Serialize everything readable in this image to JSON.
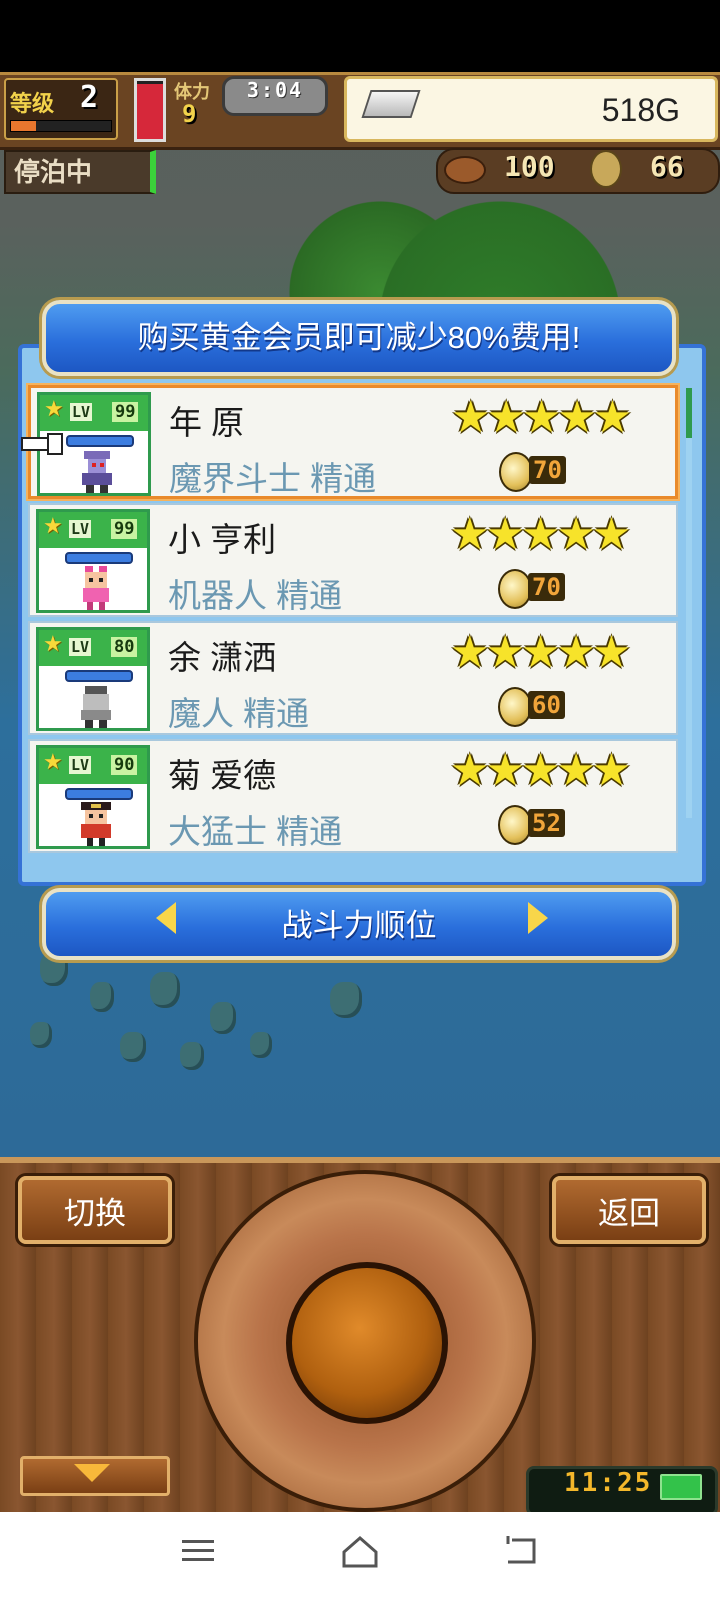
{
  "hud": {
    "level_label": "等级",
    "level_value": "2",
    "level_progress": 0.25,
    "hp_progress": 0.95,
    "stamina_label": "体力",
    "stamina_value": "9",
    "time": "3:04",
    "gold": "518G",
    "dock_status": "停泊中",
    "food": "100",
    "medals": "66"
  },
  "banner": {
    "text": "购买黄金会员即可减少80%费用!"
  },
  "candidates": [
    {
      "name": "年 原",
      "job": "魔界斗士 精通",
      "level": "99",
      "stars": 5,
      "cost": "70",
      "selected": true
    },
    {
      "name": "小 亨利",
      "job": "机器人 精通",
      "level": "99",
      "stars": 5,
      "cost": "70",
      "selected": false
    },
    {
      "name": "余 潇洒",
      "job": "魔人 精通",
      "level": "80",
      "stars": 5,
      "cost": "60",
      "selected": false
    },
    {
      "name": "菊 爱德",
      "job": "大猛士 精通",
      "level": "90",
      "stars": 5,
      "cost": "52",
      "selected": false
    }
  ],
  "labels": {
    "lv": "LV",
    "stars_text": "★★★★★"
  },
  "sort": {
    "label": "战斗力顺位"
  },
  "controls": {
    "switch_label": "切换",
    "back_label": "返回"
  },
  "clock": "11:25",
  "colors": {
    "banner_blue": "#2a6fdc",
    "selection_orange": "#e98a2b",
    "level_green": "#3bb34a",
    "star_yellow": "#f7e32a"
  }
}
